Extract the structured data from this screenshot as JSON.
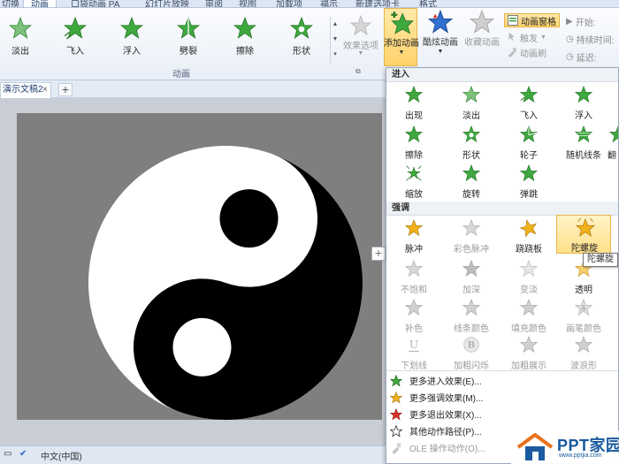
{
  "top_tabs": [
    {
      "label": "切换",
      "active": false
    },
    {
      "label": "动画",
      "active": true
    },
    {
      "label": "口袋动画 PA",
      "active": false
    },
    {
      "label": "幻灯片放映",
      "active": false
    },
    {
      "label": "审阅",
      "active": false
    },
    {
      "label": "视图",
      "active": false
    },
    {
      "label": "加载项",
      "active": false
    },
    {
      "label": "福示",
      "active": false
    },
    {
      "label": "新建选项卡",
      "active": false
    },
    {
      "label": "格式",
      "active": false
    }
  ],
  "ribbon": {
    "gallery": [
      {
        "label": "淡出",
        "icon": "star-fade-icon"
      },
      {
        "label": "飞入",
        "icon": "star-fly-in-icon"
      },
      {
        "label": "浮入",
        "icon": "star-float-in-icon"
      },
      {
        "label": "劈裂",
        "icon": "star-split-icon"
      },
      {
        "label": "擦除",
        "icon": "star-wipe-icon"
      },
      {
        "label": "形状",
        "icon": "star-shape-icon"
      }
    ],
    "effect_options_label": "效果选项",
    "group_label": "动画",
    "add_animation_label": "添加动画",
    "cool_animation_label": "酷炫动画",
    "favorite_animation_label": "收藏动画",
    "animation_pane_label": "动画窗格",
    "trigger_label": "触发",
    "animation_brush_label": "动画刷",
    "timing_start_label": "开始:",
    "timing_duration_label": "持续时间:",
    "timing_delay_label": "延迟:"
  },
  "doc_tab": {
    "label": "演示文稿2",
    "close_glyph": "×",
    "add_glyph": "+"
  },
  "status_bar": {
    "language": "中文(中国)"
  },
  "dropdown": {
    "entrance_header": "进入",
    "entrance": [
      {
        "label": "出现",
        "disabled": false
      },
      {
        "label": "淡出",
        "disabled": false
      },
      {
        "label": "飞入",
        "disabled": false
      },
      {
        "label": "浮入",
        "disabled": false
      },
      {
        "label": "擦除",
        "disabled": false
      },
      {
        "label": "形状",
        "disabled": false
      },
      {
        "label": "轮子",
        "disabled": false
      },
      {
        "label": "随机线条",
        "disabled": false
      },
      {
        "label": "翻",
        "disabled": false
      },
      {
        "label": "缩放",
        "disabled": false
      },
      {
        "label": "旋转",
        "disabled": false
      },
      {
        "label": "弹跳",
        "disabled": false
      }
    ],
    "emphasis_header": "强调",
    "emphasis": [
      {
        "label": "脉冲",
        "disabled": false
      },
      {
        "label": "彩色脉冲",
        "disabled": true
      },
      {
        "label": "跷跷板",
        "disabled": false
      },
      {
        "label": "陀螺旋",
        "disabled": false
      },
      {
        "label": "不饱和",
        "disabled": true
      },
      {
        "label": "加深",
        "disabled": true
      },
      {
        "label": "变淡",
        "disabled": true
      },
      {
        "label": "透明",
        "disabled": false
      },
      {
        "label": "补色",
        "disabled": true
      },
      {
        "label": "线条颜色",
        "disabled": true
      },
      {
        "label": "填充颜色",
        "disabled": true
      },
      {
        "label": "画笔颜色",
        "disabled": true
      },
      {
        "label": "下划线",
        "disabled": true
      },
      {
        "label": "加粗闪烁",
        "disabled": true
      },
      {
        "label": "加粗展示",
        "disabled": true
      },
      {
        "label": "波浪形",
        "disabled": true
      }
    ],
    "tooltip": "陀螺旋",
    "menu": [
      {
        "label": "更多进入效果(E)...",
        "disabled": false
      },
      {
        "label": "更多强调效果(M)...",
        "disabled": false
      },
      {
        "label": "更多退出效果(X)...",
        "disabled": false
      },
      {
        "label": "其他动作路径(P)...",
        "disabled": false
      },
      {
        "label": "OLE 操作动作(O)...",
        "disabled": true
      }
    ]
  },
  "watermark": {
    "title": "PPT家园",
    "url": "www.pptjia.com"
  },
  "colors": {
    "accent_hover": "#ffe08a",
    "star_green": "#3fa83f",
    "star_gold": "#f2b21b",
    "star_red": "#d9302a"
  }
}
